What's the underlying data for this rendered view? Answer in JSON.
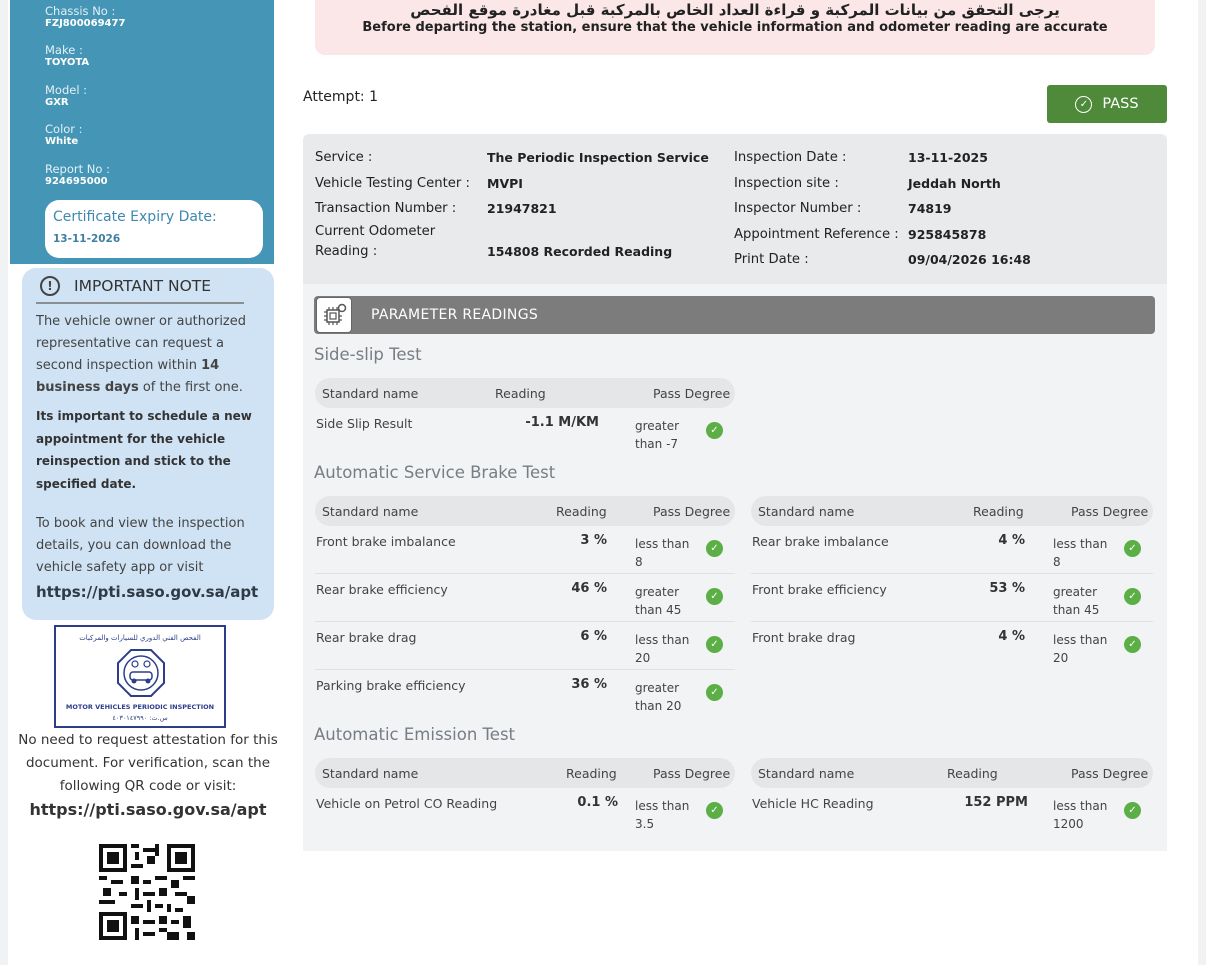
{
  "vehicle": {
    "chassis_label": "Chassis No :",
    "chassis_value": "FZJ800069477",
    "make_label": "Make :",
    "make_value": "TOYOTA",
    "model_label": "Model :",
    "model_value": "GXR",
    "color_label": "Color :",
    "color_value": "White",
    "report_label": "Report No :",
    "report_value": "924695000",
    "expiry_label": "Certificate Expiry Date:",
    "expiry_value": "13-11-2026"
  },
  "note": {
    "title": "IMPORTANT NOTE",
    "p1_a": "The vehicle owner or authorized representative can request a second inspection within ",
    "p1_bold": "14 business days",
    "p1_b": " of the first one.",
    "p2": "Its important to schedule a new appointment for the vehicle reinspection and stick to the specified date.",
    "p3": "To book and view the inspection details, you can download the vehicle safety app or visit",
    "url": "https://pti.saso.gov.sa/apt"
  },
  "stamp": {
    "arabic": "الفحص الفني الدوري للسيارات والمركبات",
    "english": "MOTOR VEHICLES PERIODIC INSPECTION",
    "number": "س.ت: ٤٠٣٠١٤٧٩٩٠"
  },
  "attestation": {
    "text": "No need to request attestation for this document. For verification, scan the following QR code or visit:",
    "url": "https://pti.saso.gov.sa/apt"
  },
  "banner": {
    "arabic": "يرجى التحقق من بيانات المركبة و قراءة العداد الخاص بالمركبة قبل مغادرة موقع الفحص",
    "english": "Before departing the station, ensure that the vehicle information and odometer reading are accurate"
  },
  "attempt": "Attempt: 1",
  "result": "PASS",
  "info": {
    "service_k": "Service :",
    "service_v": "The Periodic Inspection Service",
    "center_k": "Vehicle Testing Center :",
    "center_v": "MVPI",
    "txn_k": "Transaction Number :",
    "txn_v": "21947821",
    "odo_k": "Current Odometer Reading :",
    "odo_v": "154808 Recorded Reading",
    "date_k": "Inspection Date :",
    "date_v": "13-11-2025",
    "site_k": "Inspection site :",
    "site_v": "Jeddah North",
    "inspector_k": "Inspector Number :",
    "inspector_v": "74819",
    "appt_k": "Appointment Reference :",
    "appt_v": "925845878",
    "print_k": "Print Date :",
    "print_v": "09/04/2026 16:48"
  },
  "params": {
    "title": "PARAMETER READINGS",
    "headers": {
      "name": "Standard name",
      "reading": "Reading",
      "pass": "Pass Degree"
    },
    "sideslip": {
      "title": "Side-slip Test",
      "rows": [
        {
          "name": "Side Slip Result",
          "reading": "-1.1 M/KM",
          "pass": "greater than -7"
        }
      ]
    },
    "brake": {
      "title": "Automatic Service Brake Test",
      "left": [
        {
          "name": "Front brake imbalance",
          "reading": "3 %",
          "pass": "less than 8"
        },
        {
          "name": "Rear brake efficiency",
          "reading": "46 %",
          "pass": "greater than 45"
        },
        {
          "name": "Rear brake drag",
          "reading": "6 %",
          "pass": "less than 20"
        },
        {
          "name": "Parking brake efficiency",
          "reading": "36 %",
          "pass": "greater than 20"
        }
      ],
      "right": [
        {
          "name": "Rear brake imbalance",
          "reading": "4 %",
          "pass": "less than 8"
        },
        {
          "name": "Front brake efficiency",
          "reading": "53 %",
          "pass": "greater than 45"
        },
        {
          "name": "Front brake drag",
          "reading": "4 %",
          "pass": "less than 20"
        }
      ]
    },
    "emission": {
      "title": "Automatic Emission Test",
      "left": [
        {
          "name": "Vehicle on Petrol CO Reading",
          "reading": "0.1 %",
          "pass": "less than 3.5"
        }
      ],
      "right": [
        {
          "name": "Vehicle HC Reading",
          "reading": "152 PPM",
          "pass": "less than 1200"
        }
      ]
    }
  },
  "colors": {
    "sidebar": "#4596b6",
    "note_bg": "#cfe3f4",
    "pass": "#4e8a3a",
    "check": "#5cae46",
    "banner": "#fbe7e8"
  },
  "icons": [
    "info-icon",
    "check-circle-icon",
    "chip-gear-icon",
    "seal-icon",
    "qr-code"
  ]
}
